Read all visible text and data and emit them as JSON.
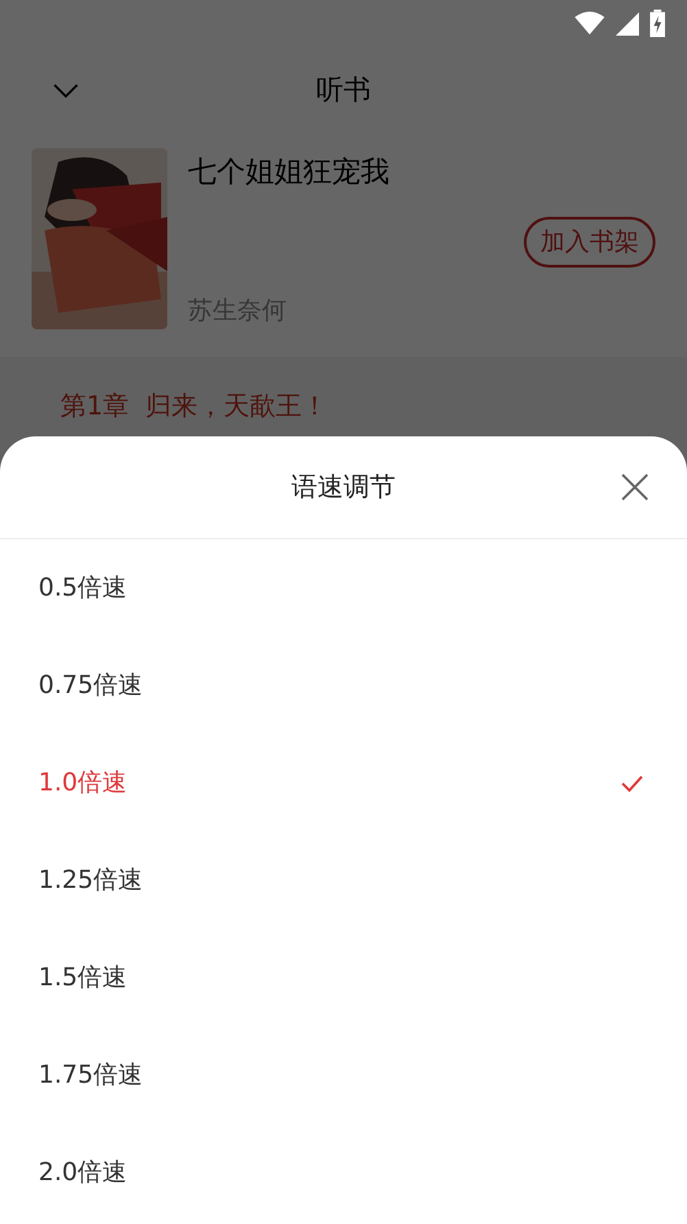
{
  "header": {
    "title": "听书"
  },
  "book": {
    "title": "七个姐姐狂宠我",
    "author": "苏生奈何",
    "add_button": "加入书架"
  },
  "chapter": {
    "title": "第1章  归来，天歃王！"
  },
  "sheet": {
    "title": "语速调节",
    "options": [
      {
        "label": "0.5倍速",
        "selected": false
      },
      {
        "label": "0.75倍速",
        "selected": false
      },
      {
        "label": "1.0倍速",
        "selected": true
      },
      {
        "label": "1.25倍速",
        "selected": false
      },
      {
        "label": "1.5倍速",
        "selected": false
      },
      {
        "label": "1.75倍速",
        "selected": false
      },
      {
        "label": "2.0倍速",
        "selected": false
      }
    ]
  }
}
